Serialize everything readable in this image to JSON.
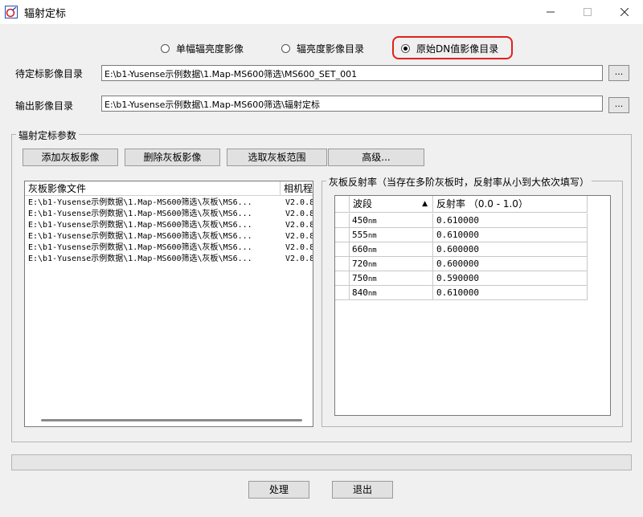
{
  "window": {
    "title": "辐射定标"
  },
  "mode": {
    "options": [
      "单幅辐亮度影像",
      "辐亮度影像目录",
      "原始DN值影像目录"
    ],
    "selected_index": 2
  },
  "input_dir": {
    "label": "待定标影像目录",
    "value": "E:\\b1-Yusense示例数据\\1.Map-MS600筛选\\MS600_SET_001",
    "browse": "..."
  },
  "output_dir": {
    "label": "输出影像目录",
    "value": "E:\\b1-Yusense示例数据\\1.Map-MS600筛选\\辐射定标",
    "browse": "..."
  },
  "params": {
    "title": "辐射定标参数",
    "buttons": [
      "添加灰板影像",
      "删除灰板影像",
      "选取灰板范围",
      "高级..."
    ],
    "list_headers": [
      "灰板影像文件",
      "相机程"
    ],
    "files": [
      {
        "path": "E:\\b1-Yusense示例数据\\1.Map-MS600筛选\\灰板\\MS6...",
        "ver": "V2.0.8"
      },
      {
        "path": "E:\\b1-Yusense示例数据\\1.Map-MS600筛选\\灰板\\MS6...",
        "ver": "V2.0.8"
      },
      {
        "path": "E:\\b1-Yusense示例数据\\1.Map-MS600筛选\\灰板\\MS6...",
        "ver": "V2.0.8"
      },
      {
        "path": "E:\\b1-Yusense示例数据\\1.Map-MS600筛选\\灰板\\MS6...",
        "ver": "V2.0.8"
      },
      {
        "path": "E:\\b1-Yusense示例数据\\1.Map-MS600筛选\\灰板\\MS6...",
        "ver": "V2.0.8"
      },
      {
        "path": "E:\\b1-Yusense示例数据\\1.Map-MS600筛选\\灰板\\MS6...",
        "ver": "V2.0.8"
      }
    ],
    "reflectance": {
      "title": "灰板反射率（当存在多阶灰板时，反射率从小到大依次填写）",
      "headers": [
        "波段",
        "反射率 （0.0 - 1.0）"
      ],
      "sort_icon": "sort-up-icon",
      "rows": [
        {
          "band": "450",
          "unit": "nm",
          "value": "0.610000"
        },
        {
          "band": "555",
          "unit": "nm",
          "value": "0.610000"
        },
        {
          "band": "660",
          "unit": "nm",
          "value": "0.600000"
        },
        {
          "band": "720",
          "unit": "nm",
          "value": "0.600000"
        },
        {
          "band": "750",
          "unit": "nm",
          "value": "0.590000"
        },
        {
          "band": "840",
          "unit": "nm",
          "value": "0.610000"
        }
      ]
    }
  },
  "actions": {
    "process": "处理",
    "exit": "退出"
  },
  "colors": {
    "highlight": "#e0201c",
    "window_bg": "#f0f0f0"
  }
}
